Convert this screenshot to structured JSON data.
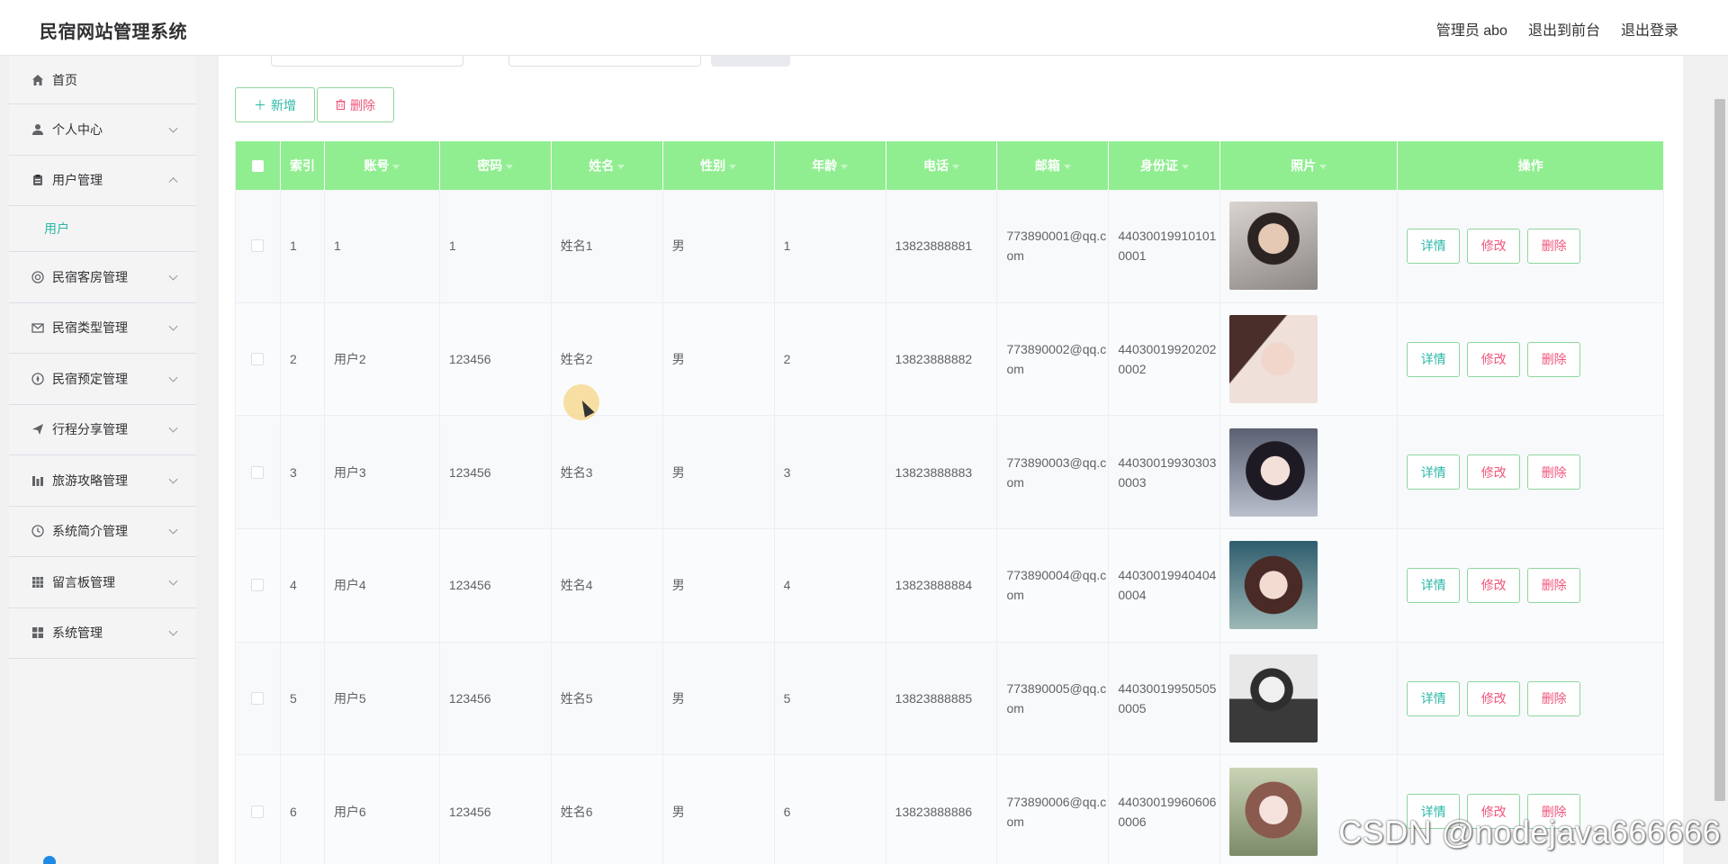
{
  "header": {
    "title": "民宿网站管理系统",
    "admin": "管理员 abo",
    "to_front": "退出到前台",
    "logout": "退出登录"
  },
  "sidebar": {
    "items": [
      {
        "label": "首页",
        "icon": "home-icon"
      },
      {
        "label": "个人中心",
        "icon": "user-icon"
      },
      {
        "label": "用户管理",
        "icon": "clipboard-icon",
        "expanded": true,
        "sub": "用户"
      },
      {
        "label": "民宿客房管理",
        "icon": "lifebuoy-icon"
      },
      {
        "label": "民宿类型管理",
        "icon": "mail-icon"
      },
      {
        "label": "民宿预定管理",
        "icon": "compass-icon"
      },
      {
        "label": "行程分享管理",
        "icon": "send-icon"
      },
      {
        "label": "旅游攻略管理",
        "icon": "chart-icon"
      },
      {
        "label": "系统简介管理",
        "icon": "clock-icon"
      },
      {
        "label": "留言板管理",
        "icon": "grid-icon"
      },
      {
        "label": "系统管理",
        "icon": "apps-icon"
      }
    ]
  },
  "actions": {
    "add": "新增",
    "delete": "删除"
  },
  "table": {
    "headers": [
      "索引",
      "账号",
      "密码",
      "姓名",
      "性别",
      "年龄",
      "电话",
      "邮箱",
      "身份证",
      "照片",
      "操作"
    ],
    "ops": {
      "detail": "详情",
      "edit": "修改",
      "remove": "删除"
    },
    "rows": [
      {
        "index": "1",
        "account": "1",
        "password": "1",
        "name": "姓名1",
        "gender": "男",
        "age": "1",
        "phone": "13823888881",
        "email": "773890001@qq.com",
        "idcard": "440300199101010001"
      },
      {
        "index": "2",
        "account": "用户2",
        "password": "123456",
        "name": "姓名2",
        "gender": "男",
        "age": "2",
        "phone": "13823888882",
        "email": "773890002@qq.com",
        "idcard": "440300199202020002"
      },
      {
        "index": "3",
        "account": "用户3",
        "password": "123456",
        "name": "姓名3",
        "gender": "男",
        "age": "3",
        "phone": "13823888883",
        "email": "773890003@qq.com",
        "idcard": "440300199303030003"
      },
      {
        "index": "4",
        "account": "用户4",
        "password": "123456",
        "name": "姓名4",
        "gender": "男",
        "age": "4",
        "phone": "13823888884",
        "email": "773890004@qq.com",
        "idcard": "440300199404040004"
      },
      {
        "index": "5",
        "account": "用户5",
        "password": "123456",
        "name": "姓名5",
        "gender": "男",
        "age": "5",
        "phone": "13823888885",
        "email": "773890005@qq.com",
        "idcard": "440300199505050005"
      },
      {
        "index": "6",
        "account": "用户6",
        "password": "123456",
        "name": "姓名6",
        "gender": "男",
        "age": "6",
        "phone": "13823888886",
        "email": "773890006@qq.com",
        "idcard": "440300199606060006"
      }
    ]
  },
  "colors": {
    "header_bg": "#90ee90",
    "accent": "#2bb7a7",
    "danger": "#f0557a"
  },
  "watermark": "CSDN @nodejava666666"
}
